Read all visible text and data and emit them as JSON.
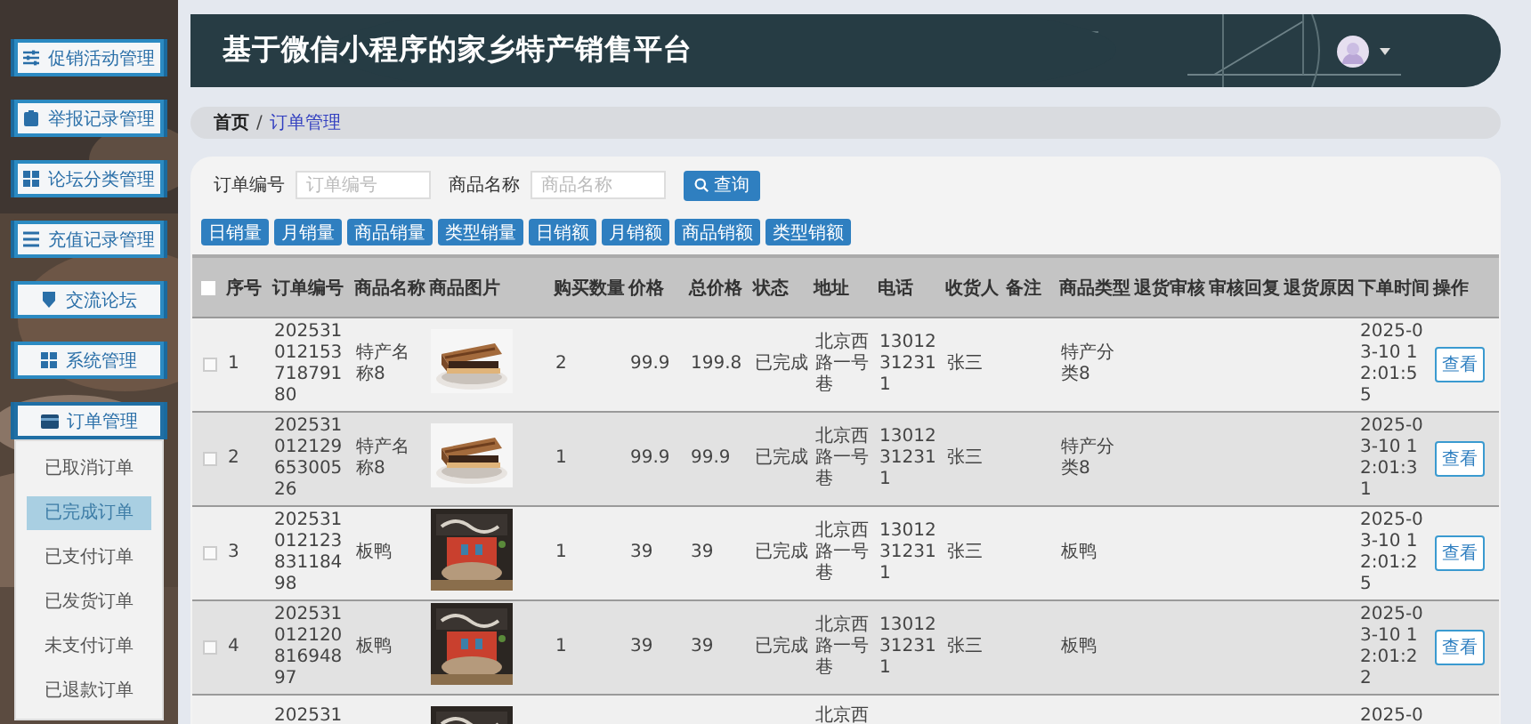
{
  "sidebar": {
    "items": [
      {
        "label": "促销活动管理",
        "expanded": false
      },
      {
        "label": "举报记录管理",
        "expanded": false
      },
      {
        "label": "论坛分类管理",
        "expanded": false
      },
      {
        "label": "充值记录管理",
        "expanded": false
      },
      {
        "label": "交流论坛",
        "expanded": false
      },
      {
        "label": "系统管理",
        "expanded": false
      },
      {
        "label": "订单管理",
        "expanded": true,
        "children": [
          {
            "label": "已取消订单",
            "selected": false
          },
          {
            "label": "已完成订单",
            "selected": true
          },
          {
            "label": "已支付订单",
            "selected": false
          },
          {
            "label": "已发货订单",
            "selected": false
          },
          {
            "label": "未支付订单",
            "selected": false
          },
          {
            "label": "已退款订单",
            "selected": false
          }
        ]
      }
    ]
  },
  "header": {
    "title": "基于微信小程序的家乡特产销售平台"
  },
  "breadcrumb": {
    "items": [
      "首页",
      "订单管理"
    ],
    "separator": "/"
  },
  "search": {
    "fields": [
      {
        "label": "订单编号",
        "placeholder": "订单编号"
      },
      {
        "label": "商品名称",
        "placeholder": "商品名称"
      }
    ],
    "button": "查询"
  },
  "report_buttons": [
    "日销量",
    "月销量",
    "商品销量",
    "类型销量",
    "日销额",
    "月销额",
    "商品销额",
    "类型销额"
  ],
  "table": {
    "select_all_checked": false,
    "columns": [
      "序号",
      "订单编号",
      "商品名称",
      "商品图片",
      "购买数量",
      "价格",
      "总价格",
      "状态",
      "地址",
      "电话",
      "收货人",
      "备注",
      "商品类型",
      "退货审核",
      "审核回复",
      "退货原因",
      "下单时间",
      "操作"
    ],
    "rows": [
      {
        "checked": false,
        "no": "1",
        "order_no": "20253101215371879180",
        "product_name": "特产名称8",
        "quantity": "2",
        "price": "99.9",
        "total": "199.8",
        "status": "已完成",
        "address": "北京西路一号巷",
        "phone": "13012312311",
        "receiver": "张三",
        "product_type": "特产分类8",
        "order_time": "2025-03-10 12:01:55",
        "action": "查看"
      },
      {
        "checked": false,
        "no": "2",
        "order_no": "20253101212965300526",
        "product_name": "特产名称8",
        "quantity": "1",
        "price": "99.9",
        "total": "99.9",
        "status": "已完成",
        "address": "北京西路一号巷",
        "phone": "13012312311",
        "receiver": "张三",
        "product_type": "特产分类8",
        "order_time": "2025-03-10 12:01:31",
        "action": "查看"
      },
      {
        "checked": false,
        "no": "3",
        "order_no": "20253101212383118498",
        "product_name": "板鸭",
        "quantity": "1",
        "price": "39",
        "total": "39",
        "status": "已完成",
        "address": "北京西路一号巷",
        "phone": "13012312311",
        "receiver": "张三",
        "product_type": "板鸭",
        "order_time": "2025-03-10 12:01:25",
        "action": "查看"
      },
      {
        "checked": false,
        "no": "4",
        "order_no": "20253101212081694897",
        "product_name": "板鸭",
        "quantity": "1",
        "price": "39",
        "total": "39",
        "status": "已完成",
        "address": "北京西路一号巷",
        "phone": "13012312311",
        "receiver": "张三",
        "product_type": "板鸭",
        "order_time": "2025-03-10 12:01:22",
        "action": "查看"
      },
      {
        "order_no": "202531",
        "address": "北京西",
        "order_time": "2025-0"
      }
    ]
  }
}
